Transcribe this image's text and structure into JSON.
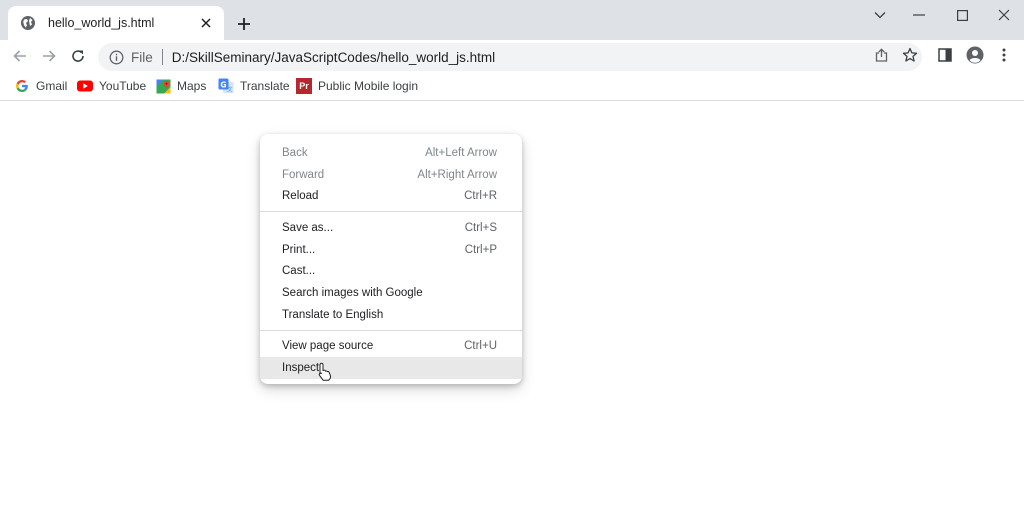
{
  "tab": {
    "title": "hello_world_js.html",
    "icon": "globe-icon"
  },
  "omnibox": {
    "scheme_label": "File",
    "url": "D:/SkillSeminary/JavaScriptCodes/hello_world_js.html"
  },
  "bookmarks": [
    {
      "label": "Gmail",
      "icon": "google-icon"
    },
    {
      "label": "YouTube",
      "icon": "youtube-icon"
    },
    {
      "label": "Maps",
      "icon": "maps-icon"
    },
    {
      "label": "Translate",
      "icon": "translate-icon"
    },
    {
      "label": "Public Mobile login",
      "icon": "pr-icon",
      "icon_text": "Pr"
    }
  ],
  "context_menu": {
    "groups": [
      [
        {
          "label": "Back",
          "shortcut": "Alt+Left Arrow",
          "disabled": true
        },
        {
          "label": "Forward",
          "shortcut": "Alt+Right Arrow",
          "disabled": true
        },
        {
          "label": "Reload",
          "shortcut": "Ctrl+R"
        }
      ],
      [
        {
          "label": "Save as...",
          "shortcut": "Ctrl+S"
        },
        {
          "label": "Print...",
          "shortcut": "Ctrl+P"
        },
        {
          "label": "Cast...",
          "shortcut": ""
        },
        {
          "label": "Search images with Google",
          "shortcut": ""
        },
        {
          "label": "Translate to English",
          "shortcut": ""
        }
      ],
      [
        {
          "label": "View page source",
          "shortcut": "Ctrl+U"
        },
        {
          "label": "Inspect",
          "shortcut": "",
          "hovered": true
        }
      ]
    ]
  },
  "colors": {
    "tabstrip_bg": "#dee1e6",
    "omnibox_bg": "#f1f3f4",
    "menu_hover": "#e8e8e9",
    "youtube_red": "#ff0000",
    "pr_red": "#b7282e"
  }
}
